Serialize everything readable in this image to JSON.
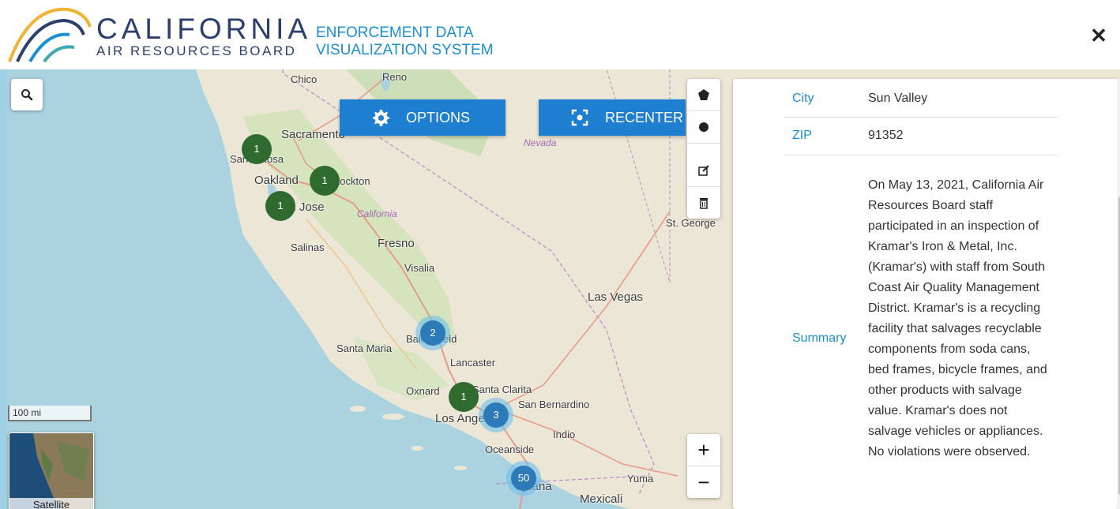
{
  "header": {
    "brand_main": "CALIFORNIA",
    "brand_sub": "AIR RESOURCES BOARD",
    "brand_eds_line1": "ENFORCEMENT DATA",
    "brand_eds_line2": "VISUALIZATION SYSTEM"
  },
  "toolbar": {
    "options_label": "OPTIONS",
    "recenter_label": "RECENTER"
  },
  "map": {
    "cities": {
      "chico": "Chico",
      "reno": "Reno",
      "sacramento": "Sacramento",
      "santa_rosa": "Santa Rosa",
      "oakland": "Oakland",
      "stockton": "Stockton",
      "san_jose": "San Jose",
      "fresno": "Fresno",
      "salinas": "Salinas",
      "visalia": "Visalia",
      "las_vegas": "Las Vegas",
      "st_george": "St. George",
      "santa_maria": "Santa Maria",
      "bakersfield": "Bakersfield",
      "lancaster": "Lancaster",
      "oxnard": "Oxnard",
      "santa_clarita": "Santa Clarita",
      "san_bernardino": "San Bernardino",
      "los_angeles": "Los Angeles",
      "indio": "Indio",
      "oceanside": "Oceanside",
      "yuma": "Yuma",
      "tijuana": "Tijuana",
      "mexicali": "Mexicali"
    },
    "states": {
      "nevada": "Nevada",
      "california": "California"
    },
    "clusters": {
      "santa_rosa": "1",
      "stockton": "1",
      "san_jose": "1",
      "bakersfield": "2",
      "santa_clarita": "1",
      "los_angeles": "3",
      "san_diego": "50"
    },
    "scale_label": "100 mi",
    "layer_label": "Satellite"
  },
  "details": {
    "city_key": "City",
    "city_value": "Sun Valley",
    "zip_key": "ZIP",
    "zip_value": "91352",
    "summary_key": "Summary",
    "summary_value": "On May 13, 2021, California Air Resources Board staff participated in an inspection of Kramar's Iron & Metal, Inc. (Kramar's) with staff from South Coast Air Quality Management District. Kramar's is a recycling facility that salvages recyclable components from soda cans, bed frames, bicycle frames, and other products with salvage value. Kramar's does not salvage vehicles or appliances. No violations were observed."
  },
  "colors": {
    "brand_navy": "#2a3f6c",
    "brand_blue": "#1b8fd1",
    "button_blue": "#1e7fd0",
    "cluster_green": "#2f6b2f",
    "cluster_blue": "#2c7ab8"
  }
}
